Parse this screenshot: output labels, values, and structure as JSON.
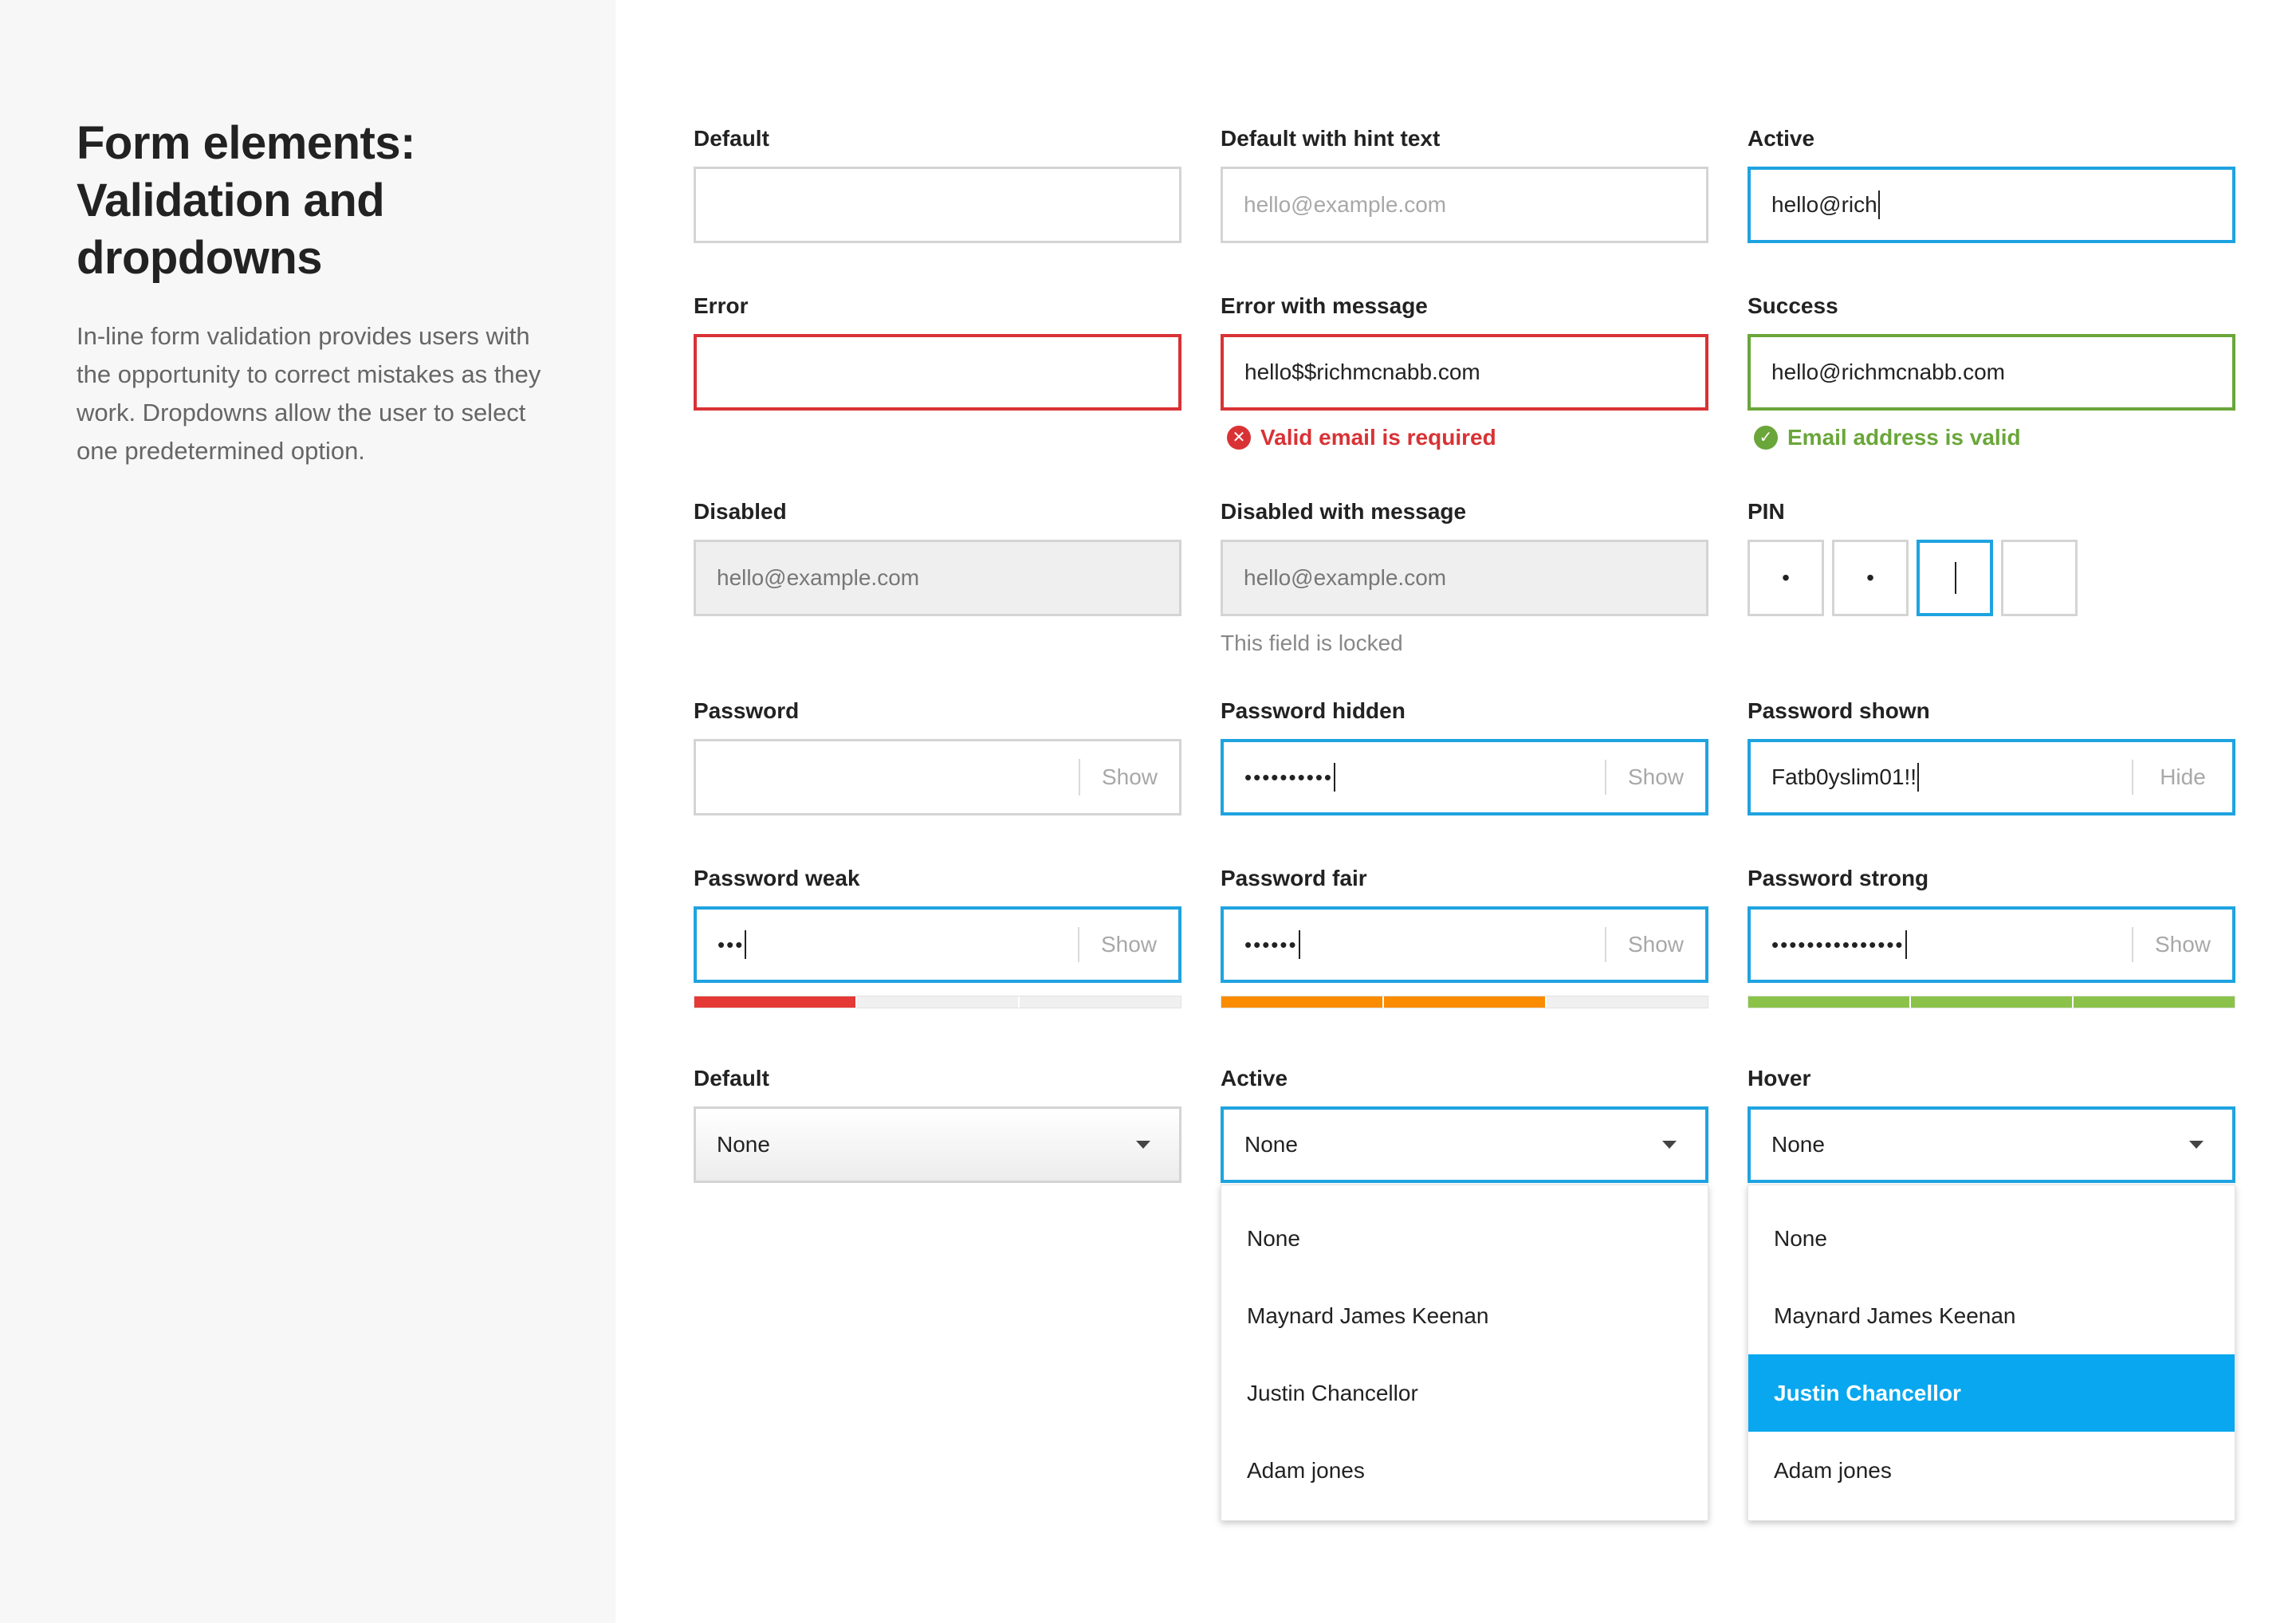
{
  "sidebar": {
    "title": "Form elements: Validation and dropdowns",
    "description": "In-line form validation provides users with the opportunity to correct mistakes as they work. Dropdowns allow the user to select one predetermined option."
  },
  "fields": {
    "default": {
      "label": "Default",
      "value": ""
    },
    "hint": {
      "label": "Default with hint text",
      "placeholder": "hello@example.com"
    },
    "active": {
      "label": "Active",
      "value": "hello@rich"
    },
    "error": {
      "label": "Error",
      "value": ""
    },
    "error_msg": {
      "label": "Error with message",
      "value": "hello$$richmcnabb.com",
      "message": "Valid email is required"
    },
    "success": {
      "label": "Success",
      "value": "hello@richmcnabb.com",
      "message": "Email address is valid"
    },
    "disabled": {
      "label": "Disabled",
      "value": "hello@example.com"
    },
    "disabled_msg": {
      "label": "Disabled with message",
      "value": "hello@example.com",
      "message": "This field is locked"
    },
    "pin": {
      "label": "PIN",
      "digits": [
        "•",
        "•",
        "",
        ""
      ]
    },
    "password": {
      "label": "Password",
      "value": "",
      "toggle": "Show"
    },
    "password_hidden": {
      "label": "Password hidden",
      "value": "••••••••••",
      "toggle": "Show"
    },
    "password_shown": {
      "label": "Password shown",
      "value": "Fatb0yslim01!!",
      "toggle": "Hide"
    },
    "password_weak": {
      "label": "Password weak",
      "value": "•••",
      "toggle": "Show",
      "strength_segments_filled": 1,
      "strength_color": "#e53935"
    },
    "password_fair": {
      "label": "Password fair",
      "value": "••••••",
      "toggle": "Show",
      "strength_segments_filled": 2,
      "strength_color": "#fb8c00"
    },
    "password_strong": {
      "label": "Password strong",
      "value": "•••••••••••••••",
      "toggle": "Show",
      "strength_segments_filled": 3,
      "strength_color": "#8bc34a"
    }
  },
  "dropdowns": {
    "default": {
      "label": "Default",
      "value": "None"
    },
    "active": {
      "label": "Active",
      "value": "None",
      "options": [
        "None",
        "Maynard James Keenan",
        "Justin Chancellor",
        "Adam jones"
      ]
    },
    "hover": {
      "label": "Hover",
      "value": "None",
      "options": [
        "None",
        "Maynard James Keenan",
        "Justin Chancellor",
        "Adam jones"
      ],
      "highlighted": "Justin Chancellor"
    }
  },
  "colors": {
    "active_border": "#1fa3e0",
    "error": "#d93235",
    "success": "#6aa63a",
    "highlight": "#08a7ef"
  },
  "icons": {
    "error_icon": "x-circle-icon",
    "success_icon": "check-circle-icon",
    "dropdown_icon": "caret-down-icon"
  }
}
